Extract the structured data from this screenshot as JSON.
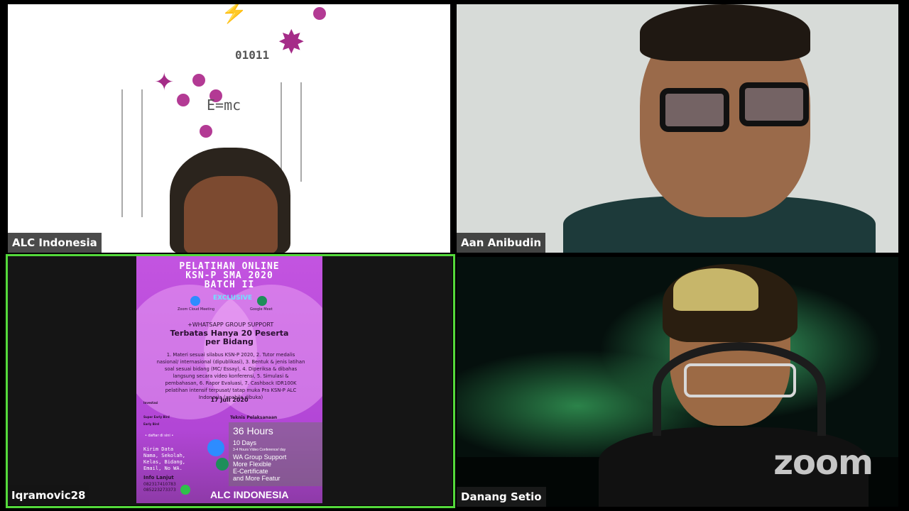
{
  "participants": [
    {
      "name": "ALC Indonesia"
    },
    {
      "name": "Aan Anibudin"
    },
    {
      "name": "Iqramovic28"
    },
    {
      "name": "Danang Setio"
    }
  ],
  "tile1": {
    "formula": "E=mc",
    "binary": "01011"
  },
  "poster": {
    "title_line1": "PELATIHAN ONLINE",
    "title_line2": "KSN-P SMA 2020",
    "title_line3": "BATCH II",
    "exclusive": "EXCLUSIVE",
    "zoom_label": "Zoom Cloud Meeting",
    "meet_label": "Google Meet",
    "wa_support": "+WHATSAPP GROUP SUPPORT",
    "limit_line1": "Terbatas Hanya 20 Peserta",
    "limit_line2": "per Bidang",
    "benefits": "1. Materi sesuai silabus KSN-P 2020, 2. Tutor medalis nasional/ internasional (dipublikasi), 3. Bentuk & jenis latihan soal sesuai bidang (MC/ Essay), 4. Diperiksa & dibahas langsung secara video konferensi, 5. Simulasi & pembahasan, 6. Rapor Evaluasi, 7. Cashback IDR100K pelatihan intensif terpusat/ tatap muka Pra KSN-P ALC Indonesia (apabila dibuka)",
    "date": "17 Juli 2020",
    "investasi": "Investasi",
    "super_early": "Super Early Bird",
    "early": "Early Bird",
    "teknis": "Teknis Pelaksanaan",
    "hours": "36 Hours",
    "features": [
      "10 Days",
      "3-4 Hours Video Conference/ day",
      "WA Group Support",
      "More Flexible",
      "E-Certificate",
      "and More Featur"
    ],
    "daftar": "• daftar di sini •",
    "kirim": [
      "Kirim Data",
      "Nama, Sekolah,",
      "Kelas, Bidang,",
      "Email, No WA."
    ],
    "info": "Info Lanjut",
    "phones": [
      "082317410783",
      "085223273373"
    ],
    "brand": "ALC INDONESIA"
  },
  "branding": {
    "logo": "zoom"
  },
  "colors": {
    "active_speaker": "#54d93b",
    "poster": "#c354e0"
  }
}
